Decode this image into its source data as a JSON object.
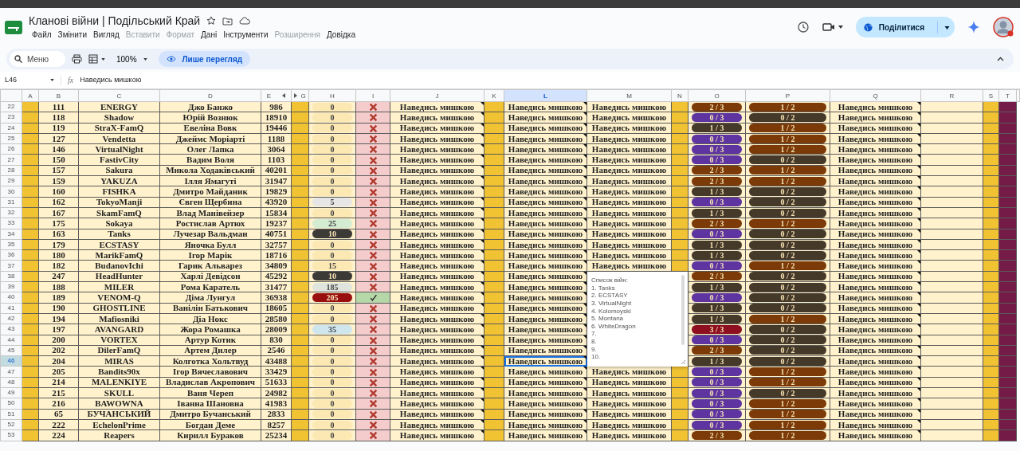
{
  "document": {
    "title": "Кланові війни | Подільський Край"
  },
  "menu": [
    {
      "label": "Файл",
      "disabled": false
    },
    {
      "label": "Змінити",
      "disabled": false
    },
    {
      "label": "Вигляд",
      "disabled": false
    },
    {
      "label": "Вставити",
      "disabled": true
    },
    {
      "label": "Формат",
      "disabled": true
    },
    {
      "label": "Дані",
      "disabled": false
    },
    {
      "label": "Інструменти",
      "disabled": false
    },
    {
      "label": "Розширення",
      "disabled": true
    },
    {
      "label": "Довідка",
      "disabled": false
    }
  ],
  "share_button": "Поділитися",
  "toolbar": {
    "search": {
      "placeholder": "Меню"
    },
    "zoom": "100%",
    "mode_button": "Лише перегляд"
  },
  "formula_bar": {
    "cell_ref": "L46",
    "fx": "fx",
    "content": "Наведись мишкою"
  },
  "columns": [
    {
      "label": "A",
      "kind": "band",
      "selected": false
    },
    {
      "label": "B",
      "kind": "data",
      "selected": false
    },
    {
      "label": "C",
      "kind": "data",
      "selected": false
    },
    {
      "label": "D",
      "kind": "data",
      "selected": false
    },
    {
      "label": "E",
      "kind": "data",
      "selected": false,
      "hidden_right": true
    },
    {
      "label": "G",
      "kind": "band",
      "selected": false,
      "hidden_left": true
    },
    {
      "label": "H",
      "kind": "data",
      "selected": false
    },
    {
      "label": "I",
      "kind": "data",
      "selected": false
    },
    {
      "label": "J",
      "kind": "data",
      "selected": false,
      "notes": true
    },
    {
      "label": "K",
      "kind": "band",
      "selected": false
    },
    {
      "label": "L",
      "kind": "data",
      "selected": true,
      "notes": true
    },
    {
      "label": "M",
      "kind": "data",
      "selected": false
    },
    {
      "label": "N",
      "kind": "band",
      "selected": false
    },
    {
      "label": "O",
      "kind": "data",
      "selected": false
    },
    {
      "label": "P",
      "kind": "data",
      "selected": false
    },
    {
      "label": "Q",
      "kind": "data",
      "selected": false,
      "notes": true
    },
    {
      "label": "R",
      "kind": "blank",
      "selected": false
    },
    {
      "label": "S",
      "kind": "band",
      "selected": false
    },
    {
      "label": "T",
      "kind": "edge",
      "selected": false
    }
  ],
  "rows": [
    {
      "number": "22",
      "selected": false,
      "B": "111",
      "C": "ENERGY",
      "D": "Джо Банжо",
      "E": "986",
      "H": {
        "text": "0",
        "color": "#fce8b2"
      },
      "I": {
        "checked": false
      },
      "J": "Наведись мишкою",
      "L": "Наведись мишкою",
      "M": "Наведись мишкою",
      "O": {
        "text": "2 / 3",
        "color": "#7b3a07"
      },
      "P": {
        "text": "1 / 2",
        "color": "#7b3a07"
      },
      "Q": "Наведись мишкою"
    },
    {
      "number": "23",
      "selected": false,
      "B": "118",
      "C": "Shadow",
      "D": "Юрій Вознюк",
      "E": "18910",
      "H": {
        "text": "0",
        "color": "#fce8b2"
      },
      "I": {
        "checked": false
      },
      "J": "Наведись мишкою",
      "L": "Наведись мишкою",
      "M": "Наведись мишкою",
      "O": {
        "text": "0 / 3",
        "color": "#5e35a0"
      },
      "P": {
        "text": "0 / 2",
        "color": "#45392a"
      },
      "Q": "Наведись мишкою"
    },
    {
      "number": "24",
      "selected": false,
      "B": "119",
      "C": "StraX-FamQ",
      "D": "Евеліна Вовк",
      "E": "19446",
      "H": {
        "text": "0",
        "color": "#fce8b2"
      },
      "I": {
        "checked": false
      },
      "J": "Наведись мишкою",
      "L": "Наведись мишкою",
      "M": "Наведись мишкою",
      "O": {
        "text": "1 / 3",
        "color": "#45392a"
      },
      "P": {
        "text": "1 / 2",
        "color": "#7b3a07"
      },
      "Q": "Наведись мишкою"
    },
    {
      "number": "25",
      "selected": false,
      "B": "127",
      "C": "Vendetta",
      "D": "Джеймс Моріарті",
      "E": "1188",
      "H": {
        "text": "0",
        "color": "#fce8b2"
      },
      "I": {
        "checked": false
      },
      "J": "Наведись мишкою",
      "L": "Наведись мишкою",
      "M": "Наведись мишкою",
      "O": {
        "text": "0 / 3",
        "color": "#5e35a0"
      },
      "P": {
        "text": "1 / 2",
        "color": "#7b3a07"
      },
      "Q": "Наведись мишкою"
    },
    {
      "number": "26",
      "selected": false,
      "B": "146",
      "C": "VirtualNight",
      "D": "Олег Лапка",
      "E": "3064",
      "H": {
        "text": "0",
        "color": "#fce8b2"
      },
      "I": {
        "checked": false
      },
      "J": "Наведись мишкою",
      "L": "Наведись мишкою",
      "M": "Наведись мишкою",
      "O": {
        "text": "0 / 3",
        "color": "#5e35a0"
      },
      "P": {
        "text": "1 / 2",
        "color": "#7b3a07"
      },
      "Q": "Наведись мишкою"
    },
    {
      "number": "27",
      "selected": false,
      "B": "150",
      "C": "FastivCity",
      "D": "Вадим Воля",
      "E": "1103",
      "H": {
        "text": "0",
        "color": "#fce8b2"
      },
      "I": {
        "checked": false
      },
      "J": "Наведись мишкою",
      "L": "Наведись мишкою",
      "M": "Наведись мишкою",
      "O": {
        "text": "0 / 3",
        "color": "#5e35a0"
      },
      "P": {
        "text": "0 / 2",
        "color": "#45392a"
      },
      "Q": "Наведись мишкою"
    },
    {
      "number": "28",
      "selected": false,
      "B": "157",
      "C": "Sakura",
      "D": "Микола Ходаківський",
      "E": "40201",
      "H": {
        "text": "0",
        "color": "#fce8b2"
      },
      "I": {
        "checked": false
      },
      "J": "Наведись мишкою",
      "L": "Наведись мишкою",
      "M": "Наведись мишкою",
      "O": {
        "text": "2 / 3",
        "color": "#7b3a07"
      },
      "P": {
        "text": "1 / 2",
        "color": "#7b3a07"
      },
      "Q": "Наведись мишкою"
    },
    {
      "number": "29",
      "selected": false,
      "B": "159",
      "C": "YAKUZA",
      "D": "Ілля Ямагуті",
      "E": "31947",
      "H": {
        "text": "0",
        "color": "#fce8b2"
      },
      "I": {
        "checked": false
      },
      "J": "Наведись мишкою",
      "L": "Наведись мишкою",
      "M": "Наведись мишкою",
      "O": {
        "text": "2 / 3",
        "color": "#7b3a07"
      },
      "P": {
        "text": "1 / 2",
        "color": "#7b3a07"
      },
      "Q": "Наведись мишкою"
    },
    {
      "number": "30",
      "selected": false,
      "B": "160",
      "C": "FISHKA",
      "D": "Дмитро Майданик",
      "E": "19829",
      "H": {
        "text": "0",
        "color": "#fce8b2"
      },
      "I": {
        "checked": false
      },
      "J": "Наведись мишкою",
      "L": "Наведись мишкою",
      "M": "Наведись мишкою",
      "O": {
        "text": "1 / 3",
        "color": "#45392a"
      },
      "P": {
        "text": "0 / 2",
        "color": "#45392a"
      },
      "Q": "Наведись мишкою"
    },
    {
      "number": "31",
      "selected": false,
      "B": "162",
      "C": "TokyoManji",
      "D": "Євген Щербина",
      "E": "43920",
      "H": {
        "text": "5",
        "color": "#e6e6e6"
      },
      "I": {
        "checked": false
      },
      "J": "Наведись мишкою",
      "L": "Наведись мишкою",
      "M": "Наведись мишкою",
      "O": {
        "text": "0 / 3",
        "color": "#5e35a0"
      },
      "P": {
        "text": "0 / 2",
        "color": "#45392a"
      },
      "Q": "Наведись мишкою"
    },
    {
      "number": "32",
      "selected": false,
      "B": "167",
      "C": "SkamFamQ",
      "D": "Влад Манівейзер",
      "E": "15834",
      "H": {
        "text": "0",
        "color": "#fce8b2"
      },
      "I": {
        "checked": false
      },
      "J": "Наведись мишкою",
      "L": "Наведись мишкою",
      "M": "Наведись мишкою",
      "O": {
        "text": "1 / 3",
        "color": "#45392a"
      },
      "P": {
        "text": "0 / 2",
        "color": "#45392a"
      },
      "Q": "Наведись мишкою"
    },
    {
      "number": "33",
      "selected": false,
      "B": "175",
      "C": "Sokaya",
      "D": "Ростислав Артюх",
      "E": "19237",
      "H": {
        "text": "25",
        "color": "#d4ecd2"
      },
      "I": {
        "checked": false
      },
      "J": "Наведись мишкою",
      "L": "Наведись мишкою",
      "M": "Наведись мишкою",
      "O": {
        "text": "2 / 3",
        "color": "#7b3a07"
      },
      "P": {
        "text": "1 / 2",
        "color": "#7b3a07"
      },
      "Q": "Наведись мишкою"
    },
    {
      "number": "34",
      "selected": false,
      "B": "163",
      "C": "Tanks",
      "D": "Лучезар Вальдман",
      "E": "40751",
      "H": {
        "text": "10",
        "color": "#3c3a36"
      },
      "I": {
        "checked": false
      },
      "J": "Наведись мишкою",
      "L": "Наведись мишкою",
      "M": "Наведись мишкою",
      "O": {
        "text": "0 / 3",
        "color": "#5e35a0"
      },
      "P": {
        "text": "0 / 2",
        "color": "#45392a"
      },
      "Q": "Наведись мишкою"
    },
    {
      "number": "35",
      "selected": false,
      "B": "179",
      "C": "ECSTASY",
      "D": "Яночка Булл",
      "E": "32757",
      "H": {
        "text": "0",
        "color": "#fce8b2"
      },
      "I": {
        "checked": false
      },
      "J": "Наведись мишкою",
      "L": "Наведись мишкою",
      "M": "Наведись мишкою",
      "O": {
        "text": "1 / 3",
        "color": "#45392a"
      },
      "P": {
        "text": "0 / 2",
        "color": "#45392a"
      },
      "Q": "Наведись мишкою"
    },
    {
      "number": "36",
      "selected": false,
      "B": "180",
      "C": "MarikFamQ",
      "D": "Ігор Марік",
      "E": "18716",
      "H": {
        "text": "0",
        "color": "#fce8b2"
      },
      "I": {
        "checked": false
      },
      "J": "Наведись мишкою",
      "L": "Наведись мишкою",
      "M": "Наведись мишкою",
      "O": {
        "text": "1 / 3",
        "color": "#45392a"
      },
      "P": {
        "text": "0 / 2",
        "color": "#45392a"
      },
      "Q": "Наведись мишкою"
    },
    {
      "number": "37",
      "selected": false,
      "B": "182",
      "C": "BudanovIchi",
      "D": "Гарик Альварез",
      "E": "34809",
      "H": {
        "text": "15",
        "color": "#fce8b2"
      },
      "I": {
        "checked": false
      },
      "J": "Наведись мишкою",
      "L": "Наведись мишкою",
      "M": "Наведись мишкою",
      "O": {
        "text": "0 / 3",
        "color": "#5e35a0"
      },
      "P": {
        "text": "1 / 2",
        "color": "#7b3a07"
      },
      "Q": "Наведись мишкою"
    },
    {
      "number": "38",
      "selected": false,
      "B": "247",
      "C": "HeadHunter",
      "D": "Харлі Девідсон",
      "E": "45292",
      "H": {
        "text": "10",
        "color": "#3c3a36"
      },
      "I": {
        "checked": false
      },
      "J": "Наведись мишкою",
      "L": "Наведись мишкою",
      "O": {
        "text": "2 / 3",
        "color": "#7b3a07"
      },
      "P": {
        "text": "0 / 2",
        "color": "#45392a"
      },
      "Q": "Наведись мишкою"
    },
    {
      "number": "39",
      "selected": false,
      "B": "188",
      "C": "MILER",
      "D": "Рома Каратель",
      "E": "31477",
      "H": {
        "text": "185",
        "color": "#dfe4dc"
      },
      "I": {
        "checked": false
      },
      "J": "Наведись мишкою",
      "L": "Наведись мишкою",
      "O": {
        "text": "1 / 3",
        "color": "#45392a"
      },
      "P": {
        "text": "0 / 2",
        "color": "#45392a"
      },
      "Q": "Наведись мишкою"
    },
    {
      "number": "40",
      "selected": false,
      "B": "189",
      "C": "VENOM-Q",
      "D": "Діма Лунгул",
      "E": "36938",
      "H": {
        "text": "205",
        "color": "#990f0f"
      },
      "I": {
        "checked": true
      },
      "J": "Наведись мишкою",
      "L": "Наведись мишкою",
      "O": {
        "text": "0 / 3",
        "color": "#5e35a0"
      },
      "P": {
        "text": "0 / 2",
        "color": "#45392a"
      },
      "Q": "Наведись мишкою"
    },
    {
      "number": "41",
      "selected": false,
      "B": "190",
      "C": "GHOSTLINE",
      "D": "Ванілін Батькович",
      "E": "18605",
      "H": {
        "text": "0",
        "color": "#fce8b2"
      },
      "I": {
        "checked": false
      },
      "J": "Наведись мишкою",
      "L": "Наведись мишкою",
      "O": {
        "text": "1 / 3",
        "color": "#45392a"
      },
      "P": {
        "text": "0 / 2",
        "color": "#45392a"
      },
      "Q": "Наведись мишкою"
    },
    {
      "number": "42",
      "selected": false,
      "B": "194",
      "C": "Mafiosniki",
      "D": "Діа Нокс",
      "E": "28580",
      "H": {
        "text": "0",
        "color": "#fce8b2"
      },
      "I": {
        "checked": false
      },
      "J": "Наведись мишкою",
      "L": "Наведись мишкою",
      "O": {
        "text": "1 / 3",
        "color": "#45392a"
      },
      "P": {
        "text": "1 / 2",
        "color": "#7b3a07"
      },
      "Q": "Наведись мишкою"
    },
    {
      "number": "43",
      "selected": false,
      "B": "197",
      "C": "AVANGARD",
      "D": "Жора Ромашка",
      "E": "28009",
      "H": {
        "text": "35",
        "color": "#cfe6ee"
      },
      "I": {
        "checked": false
      },
      "J": "Наведись мишкою",
      "L": "Наведись мишкою",
      "O": {
        "text": "3 / 3",
        "color": "#8e1020"
      },
      "P": {
        "text": "0 / 2",
        "color": "#45392a"
      },
      "Q": "Наведись мишкою"
    },
    {
      "number": "44",
      "selected": false,
      "B": "200",
      "C": "VORTEX",
      "D": "Артур Котик",
      "E": "830",
      "H": {
        "text": "0",
        "color": "#fce8b2"
      },
      "I": {
        "checked": false
      },
      "J": "Наведись мишкою",
      "L": "Наведись мишкою",
      "O": {
        "text": "0 / 3",
        "color": "#5e35a0"
      },
      "P": {
        "text": "0 / 2",
        "color": "#45392a"
      },
      "Q": "Наведись мишкою"
    },
    {
      "number": "45",
      "selected": false,
      "B": "202",
      "C": "DilerFamQ",
      "D": "Артем Дилер",
      "E": "2546",
      "H": {
        "text": "0",
        "color": "#fce8b2"
      },
      "I": {
        "checked": false
      },
      "J": "Наведись мишкою",
      "L": "Наведись мишкою",
      "O": {
        "text": "2 / 3",
        "color": "#7b3a07"
      },
      "P": {
        "text": "0 / 2",
        "color": "#45392a"
      },
      "Q": "Наведись мишкою"
    },
    {
      "number": "46",
      "selected": true,
      "B": "204",
      "C": "MIRAS",
      "D": "Колготка Хольтвуд",
      "E": "43488",
      "H": {
        "text": "0",
        "color": "#fce8b2"
      },
      "I": {
        "checked": false
      },
      "J": "Наведись мишкою",
      "L": "Наведись мишкою",
      "O": {
        "text": "1 / 3",
        "color": "#45392a"
      },
      "P": {
        "text": "0 / 2",
        "color": "#45392a"
      },
      "Q": "Наведись мишкою"
    },
    {
      "number": "47",
      "selected": false,
      "B": "205",
      "C": "Bandits90x",
      "D": "Ігор Вячеславович",
      "E": "33429",
      "H": {
        "text": "0",
        "color": "#fce8b2"
      },
      "I": {
        "checked": false
      },
      "J": "Наведись мишкою",
      "L": "Наведись мишкою",
      "M": "Наведись мишкою",
      "O": {
        "text": "0 / 3",
        "color": "#5e35a0"
      },
      "P": {
        "text": "1 / 2",
        "color": "#7b3a07"
      },
      "Q": "Наведись мишкою"
    },
    {
      "number": "48",
      "selected": false,
      "B": "214",
      "C": "MALENKIYE",
      "D": "Владислав Акропович",
      "E": "51633",
      "H": {
        "text": "0",
        "color": "#fce8b2"
      },
      "I": {
        "checked": false
      },
      "J": "Наведись мишкою",
      "L": "Наведись мишкою",
      "M": "Наведись мишкою",
      "O": {
        "text": "0 / 3",
        "color": "#5e35a0"
      },
      "P": {
        "text": "1 / 2",
        "color": "#7b3a07"
      },
      "Q": "Наведись мишкою"
    },
    {
      "number": "49",
      "selected": false,
      "B": "215",
      "C": "SKULL",
      "D": "Ваня Череп",
      "E": "24982",
      "H": {
        "text": "0",
        "color": "#fce8b2"
      },
      "I": {
        "checked": false
      },
      "J": "Наведись мишкою",
      "L": "Наведись мишкою",
      "M": "Наведись мишкою",
      "O": {
        "text": "0 / 3",
        "color": "#5e35a0"
      },
      "P": {
        "text": "0 / 2",
        "color": "#45392a"
      },
      "Q": "Наведись мишкою"
    },
    {
      "number": "50",
      "selected": false,
      "B": "216",
      "C": "BAWOWNA",
      "D": "Іванна Шановна",
      "E": "41983",
      "H": {
        "text": "0",
        "color": "#fce8b2"
      },
      "I": {
        "checked": false
      },
      "J": "Наведись мишкою",
      "L": "Наведись мишкою",
      "M": "Наведись мишкою",
      "O": {
        "text": "0 / 3",
        "color": "#5e35a0"
      },
      "P": {
        "text": "1 / 2",
        "color": "#7b3a07"
      },
      "Q": "Наведись мишкою"
    },
    {
      "number": "51",
      "selected": false,
      "B": "65",
      "C": "БУЧАНСЬКИЙ",
      "D": "Дмитро Бучанський",
      "E": "2833",
      "H": {
        "text": "0",
        "color": "#fce8b2"
      },
      "I": {
        "checked": false
      },
      "J": "Наведись мишкою",
      "L": "Наведись мишкою",
      "M": "Наведись мишкою",
      "O": {
        "text": "0 / 3",
        "color": "#5e35a0"
      },
      "P": {
        "text": "1 / 2",
        "color": "#7b3a07"
      },
      "Q": "Наведись мишкою"
    },
    {
      "number": "52",
      "selected": false,
      "B": "222",
      "C": "EchelonPrime",
      "D": "Богдан Деме",
      "E": "8257",
      "H": {
        "text": "0",
        "color": "#fce8b2"
      },
      "I": {
        "checked": false
      },
      "J": "Наведись мишкою",
      "L": "Наведись мишкою",
      "M": "Наведись мишкою",
      "O": {
        "text": "0 / 3",
        "color": "#5e35a0"
      },
      "P": {
        "text": "1 / 2",
        "color": "#7b3a07"
      },
      "Q": "Наведись мишкою"
    },
    {
      "number": "53",
      "selected": false,
      "B": "224",
      "C": "Reapers",
      "D": "Кирилл Бураков",
      "E": "25234",
      "H": {
        "text": "0",
        "color": "#fce8b2"
      },
      "I": {
        "checked": false
      },
      "J": "Наведись мишкою",
      "L": "Наведись мишкою",
      "M": "Наведись мишкою",
      "O": {
        "text": "2 / 3",
        "color": "#7b3a07"
      },
      "P": {
        "text": "1 / 2",
        "color": "#7b3a07"
      },
      "Q": "Наведись мишкою"
    }
  ],
  "comment": {
    "lines": [
      "Список війн:",
      "1. Tanks",
      "2. ECSTASY",
      "3. VirtualNight",
      "4. Kolomoyski",
      "5. Montana",
      "6. WhiteDragon",
      "7.",
      "8.",
      "9.",
      "10."
    ]
  }
}
